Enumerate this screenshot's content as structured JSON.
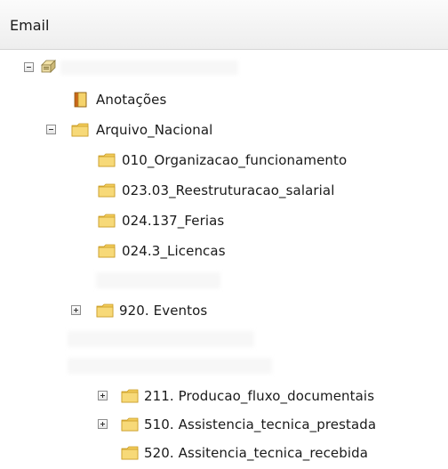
{
  "pane": {
    "title": "Email"
  },
  "tree": {
    "root_label": "",
    "items": [
      {
        "label": "Anotações",
        "icon": "notes-icon"
      },
      {
        "label": "Arquivo_Nacional",
        "icon": "folder-icon",
        "expanded": true
      },
      {
        "label": "010_Organizacao_funcionamento",
        "icon": "folder-icon"
      },
      {
        "label": "023.03_Reestruturacao_salarial",
        "icon": "folder-icon"
      },
      {
        "label": "024.137_Ferias",
        "icon": "folder-icon"
      },
      {
        "label": "024.3_Licencas",
        "icon": "folder-icon"
      },
      {
        "label": "920. Eventos",
        "icon": "folder-icon",
        "expanded": false
      },
      {
        "label": "211. Producao_fluxo_documentais",
        "icon": "folder-icon",
        "expanded": false
      },
      {
        "label": "510. Assistencia_tecnica_prestada",
        "icon": "folder-icon",
        "expanded": false
      },
      {
        "label": "520. Assitencia_tecnica_recebida",
        "icon": "folder-icon"
      }
    ]
  },
  "colors": {
    "folder": "#f2cc5b",
    "folder_dark": "#c99a22",
    "header_bg": "#f2f2f2"
  }
}
